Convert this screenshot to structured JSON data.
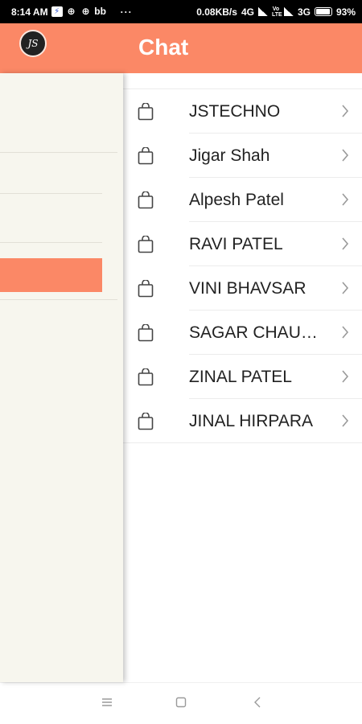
{
  "status_bar": {
    "time": "8:14 AM",
    "icon_a": "⚡",
    "icon_b": "⊕",
    "icon_c": "⊕",
    "icon_d": "bb",
    "dots": "···",
    "speed": "0.08KB/s",
    "network_a": "4G",
    "network_b": "3G",
    "volte": "Vo LTE",
    "battery": "93%"
  },
  "app_bar": {
    "title": "Chat",
    "logo_text": "JS",
    "color": "#fb8866"
  },
  "chat_list": [
    {
      "name": "JSTECHNO"
    },
    {
      "name": "Jigar Shah"
    },
    {
      "name": "Alpesh Patel"
    },
    {
      "name": "RAVI PATEL"
    },
    {
      "name": "VINI BHAVSAR"
    },
    {
      "name": "SAGAR CHAUHAN"
    },
    {
      "name": "ZINAL PATEL"
    },
    {
      "name": "JINAL HIRPARA"
    }
  ],
  "icons": {
    "row_icon": "shopping-bag-icon",
    "row_arrow": "chevron-right-icon",
    "nav": [
      "menu-icon",
      "home-square-icon",
      "back-icon"
    ]
  }
}
